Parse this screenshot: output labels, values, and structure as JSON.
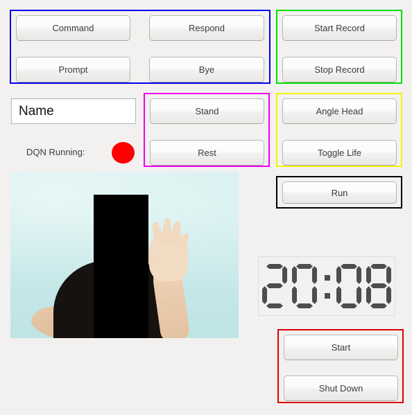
{
  "window": {
    "background_color": "#f2f1f0"
  },
  "groups": {
    "dialogue": {
      "frame_color": "#0000f0",
      "buttons": [
        {
          "label": "Command"
        },
        {
          "label": "Respond"
        },
        {
          "label": "Prompt"
        },
        {
          "label": "Bye"
        }
      ]
    },
    "recording": {
      "frame_color": "#00e000",
      "buttons": [
        {
          "label": "Start Record"
        },
        {
          "label": "Stop Record"
        }
      ]
    },
    "posture": {
      "frame_color": "#f000f0",
      "buttons": [
        {
          "label": "Stand"
        },
        {
          "label": "Rest"
        }
      ]
    },
    "behaviour": {
      "frame_color": "#f5f500",
      "buttons": [
        {
          "label": "Angle Head"
        },
        {
          "label": "Toggle Life"
        }
      ]
    },
    "execute": {
      "frame_color": "#000000",
      "buttons": [
        {
          "label": "Run"
        }
      ]
    },
    "power": {
      "frame_color": "#e00000",
      "buttons": [
        {
          "label": "Start"
        },
        {
          "label": "Shut Down"
        }
      ]
    }
  },
  "name_field": {
    "value": "Name",
    "placeholder": "Name"
  },
  "status": {
    "label": "DQN Running:",
    "indicator_color": "#fe0000",
    "indicator_state": "on"
  },
  "video": {
    "caption": "webcam-feed"
  },
  "clock": {
    "display": "20:08",
    "hours": "20",
    "minutes": "08",
    "separator": ":",
    "segment_color": "#4d4d4d"
  }
}
